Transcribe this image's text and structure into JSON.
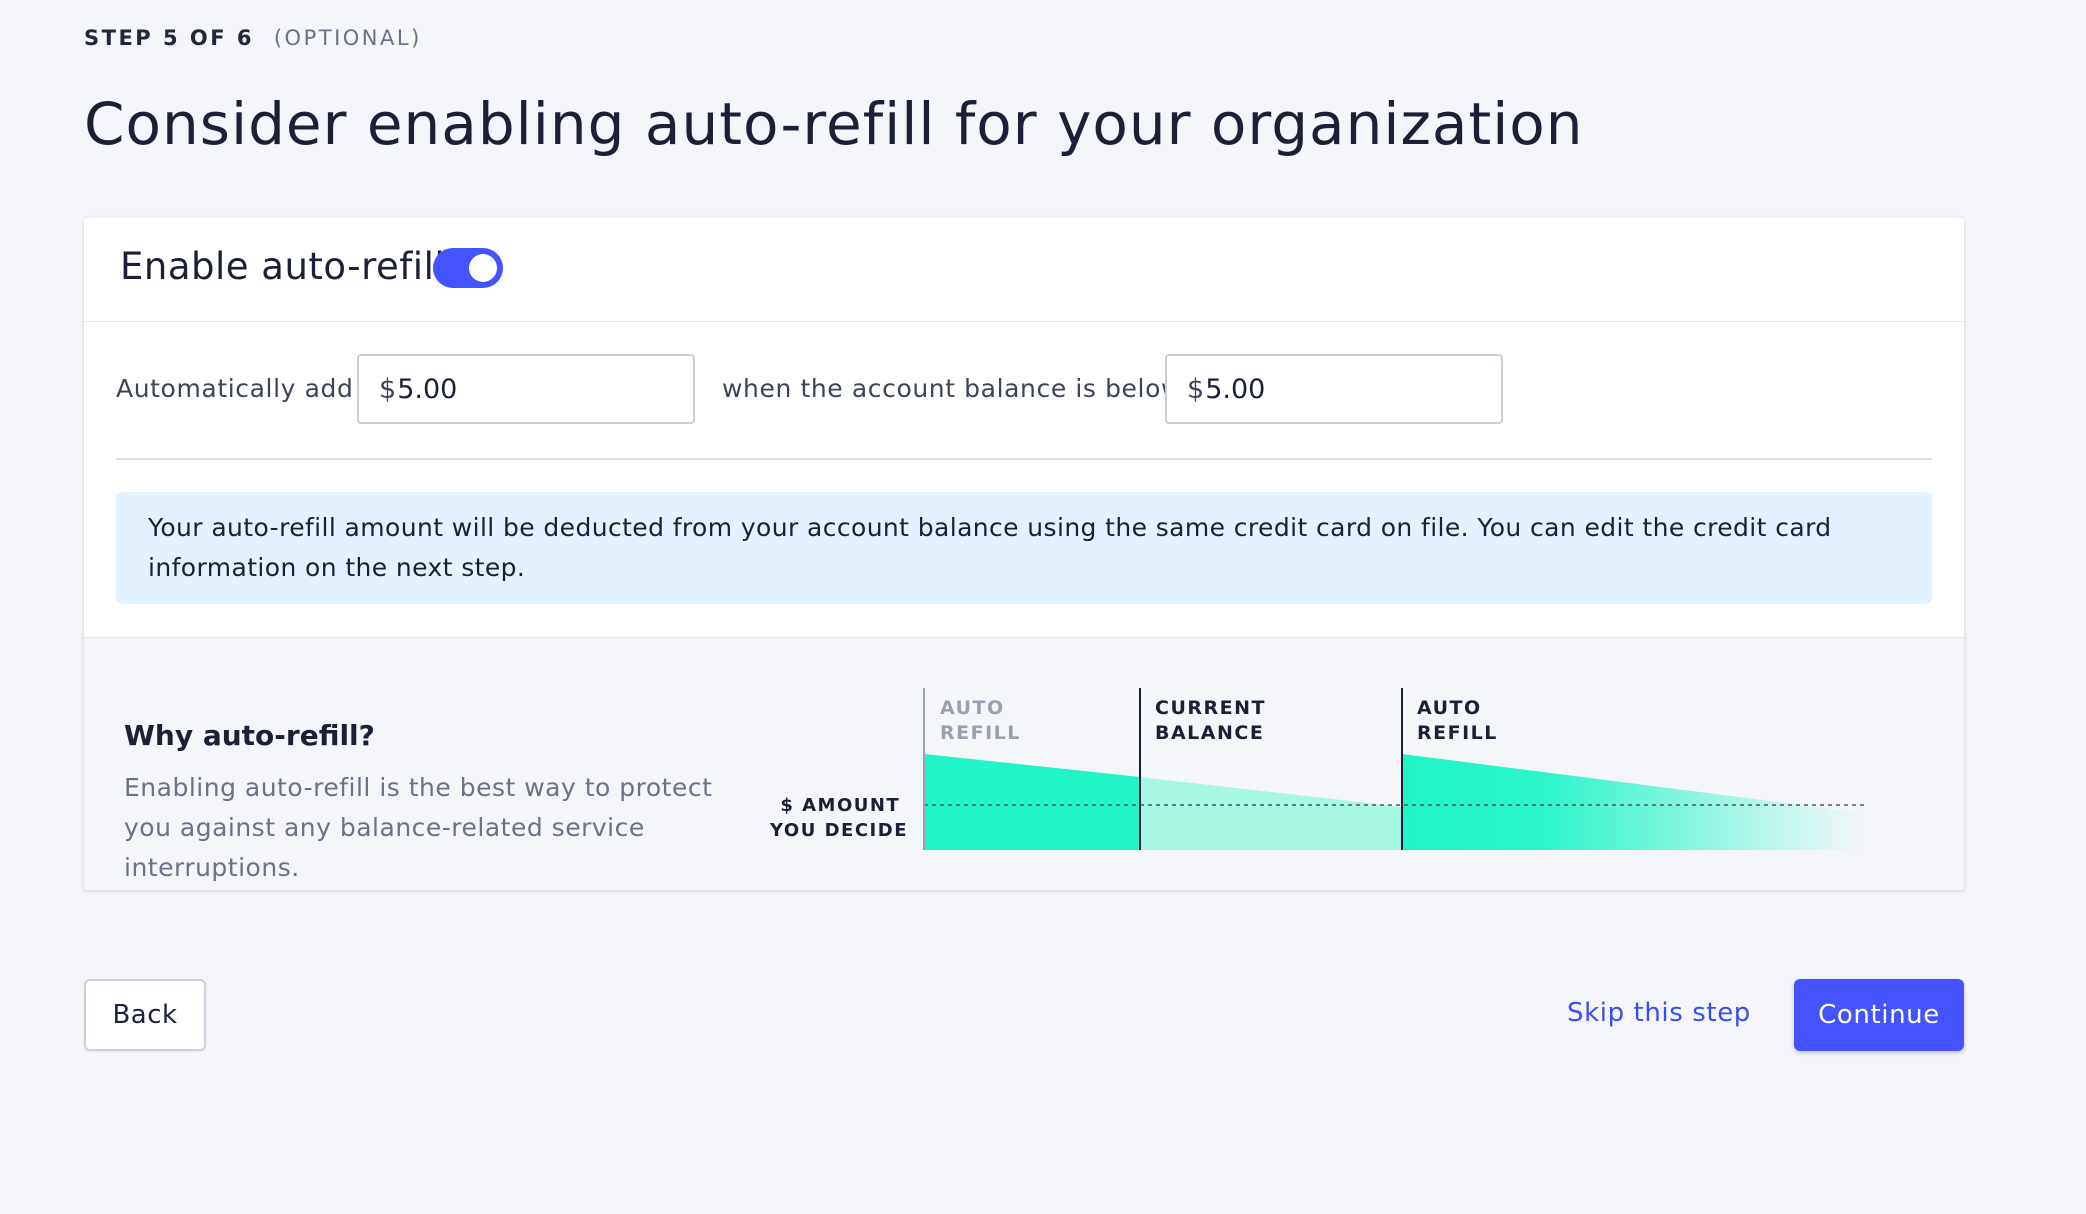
{
  "header": {
    "step": "STEP 5 OF 6",
    "optional": "(OPTIONAL)",
    "title": "Consider enabling auto-refill for your organization"
  },
  "auto_refill": {
    "toggle_label": "Enable auto-refill",
    "enabled": true,
    "add_label": "Automatically add",
    "add_currency": "$",
    "add_value": "5.00",
    "threshold_label": "when the account balance is below",
    "threshold_currency": "$",
    "threshold_value": "5.00",
    "notice": "Your auto-refill amount will be deducted from your account balance using the same credit card on file. You can edit the credit card information on the next step."
  },
  "why": {
    "title": "Why auto-refill?",
    "text": "Enabling auto-refill is the best way to protect you against any balance-related service interruptions.",
    "diagram": {
      "marker_1": [
        "AUTO",
        "REFILL"
      ],
      "marker_2": [
        "CURRENT",
        "BALANCE"
      ],
      "marker_3": [
        "AUTO",
        "REFILL"
      ],
      "threshold_label": [
        "$ AMOUNT",
        "YOU DECIDE"
      ]
    }
  },
  "footer": {
    "back_label": "Back",
    "skip_label": "Skip this step",
    "continue_label": "Continue"
  },
  "colors": {
    "accent": "#4353ff",
    "link": "#3b4cf5",
    "notice_bg": "#e3f2fc",
    "fill_strong": "#20f5c6",
    "fill_light": "#a6f8e3"
  }
}
